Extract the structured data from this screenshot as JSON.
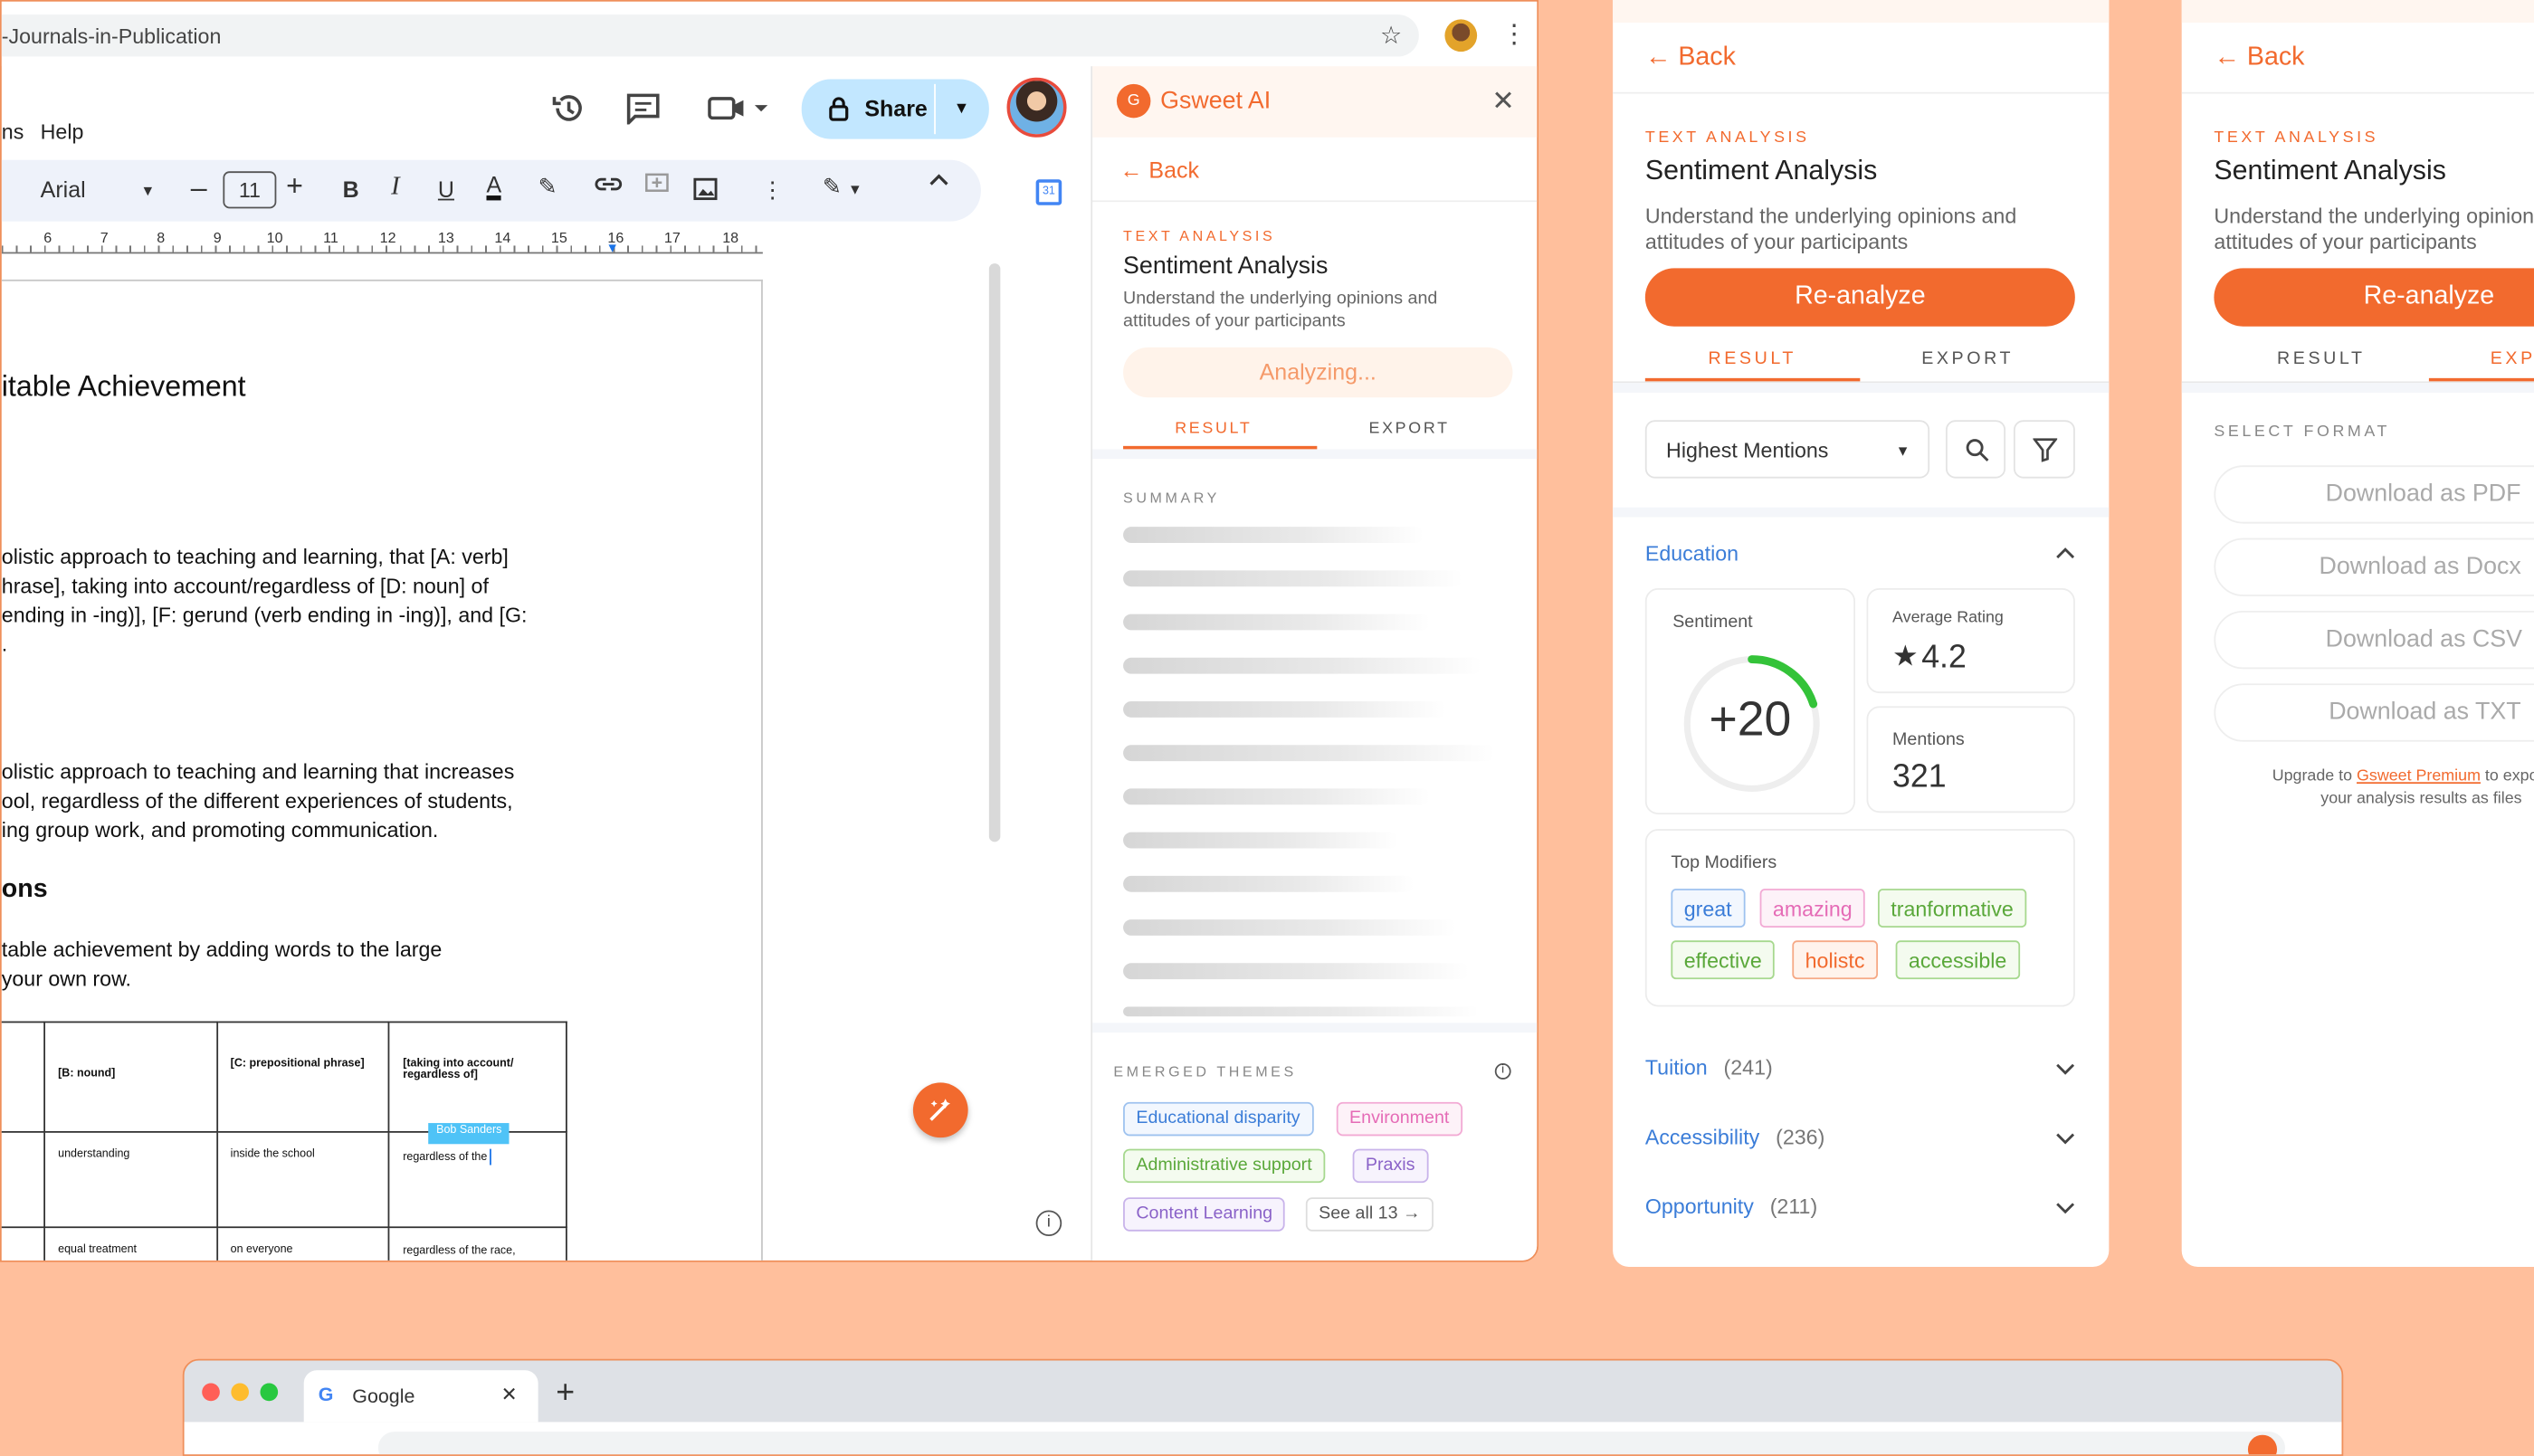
{
  "docs": {
    "address": "-Journals-in-Publication",
    "menu_fragment": "ns",
    "menu_help": "Help",
    "share_label": "Share",
    "font": "Arial",
    "font_size": "11",
    "ruler": [
      "6",
      "7",
      "8",
      "9",
      "10",
      "11",
      "12",
      "13",
      "14",
      "15",
      "16",
      "17",
      "18"
    ],
    "title": "itable Achievement",
    "para1": [
      "olistic approach to teaching and learning, that [A: verb]",
      "hrase], taking into account/regardless of [D: noun] of",
      "ending in -ing)], [F: gerund (verb ending in -ing)], and [G:",
      "."
    ],
    "para2": [
      "olistic approach to teaching and learning that increases",
      "ool, regardless of the different experiences of students,",
      "ing group work, and promoting communication."
    ],
    "heading": "ons",
    "para3": [
      "table achievement by adding words to the large",
      "your own row."
    ],
    "table": {
      "headers": [
        "[B: nound]",
        "[C: prepositional phrase]",
        "[taking into account/ regardless of]"
      ],
      "row1": [
        "understanding",
        "inside the school",
        "regardless of the"
      ],
      "row2": [
        "equal treatment",
        "on everyone",
        "regardless of the race, gender, and social"
      ]
    },
    "cursor_name": "Bob Sanders"
  },
  "panel": {
    "app_name": "Gsweet AI",
    "back": "Back",
    "eyebrow": "Text Analysis",
    "title": "Sentiment Analysis",
    "description": "Understand the underlying opinions and attitudes of your participants",
    "analyzing": "Analyzing...",
    "tab_result": "RESULT",
    "tab_export": "EXPORT",
    "summary_label": "Summary",
    "themes_label": "Emerged Themes",
    "themes": [
      "Educational disparity",
      "Environment",
      "Administrative support",
      "Praxis",
      "Content Learning"
    ],
    "see_all": "See all 13"
  },
  "result_card": {
    "back": "Back",
    "eyebrow": "Text Analysis",
    "title": "Sentiment Analysis",
    "description": "Understand the underlying opinions and attitudes of your participants",
    "reanalyze": "Re-analyze",
    "tab_result": "RESULT",
    "tab_export": "EXPORT",
    "sort": "Highest Mentions",
    "sentiment_label": "Sentiment",
    "sentiment_score": "+20",
    "sentiment_gauge_fraction": 0.2,
    "avg_rating_label": "Average Rating",
    "avg_rating": "4.2",
    "mentions_label": "Mentions",
    "mentions": "321",
    "modifiers_label": "Top Modifiers",
    "modifiers": [
      "great",
      "amazing",
      "tranformative",
      "effective",
      "holistc",
      "accessible"
    ],
    "categories": [
      {
        "name": "Education",
        "count": ""
      },
      {
        "name": "Tuition",
        "count": "(241)"
      },
      {
        "name": "Accessibility",
        "count": "(236)"
      },
      {
        "name": "Opportunity",
        "count": "(211)"
      }
    ]
  },
  "export_card": {
    "back": "Back",
    "eyebrow": "Text Analysis",
    "title": "Sentiment Analysis",
    "description": "Understand the underlying opinions and attitudes of your participants",
    "reanalyze": "Re-analyze",
    "tab_result": "RESULT",
    "tab_export": "EXPORT",
    "select_format": "Select Format",
    "downloads": [
      "Download as PDF",
      "Download as Docx",
      "Download as CSV",
      "Download as TXT"
    ],
    "upgrade_prefix": "Upgrade to",
    "upgrade_link": "Gsweet Premium",
    "upgrade_suffix": "to export",
    "upgrade_line2": "your analysis results as files"
  },
  "bottom_browser": {
    "tab_title": "Google"
  },
  "colors": {
    "accent": "#f26a2e",
    "background": "#ffbf9c",
    "link_blue": "#3b7dd8",
    "gauge_green": "#34c339"
  }
}
